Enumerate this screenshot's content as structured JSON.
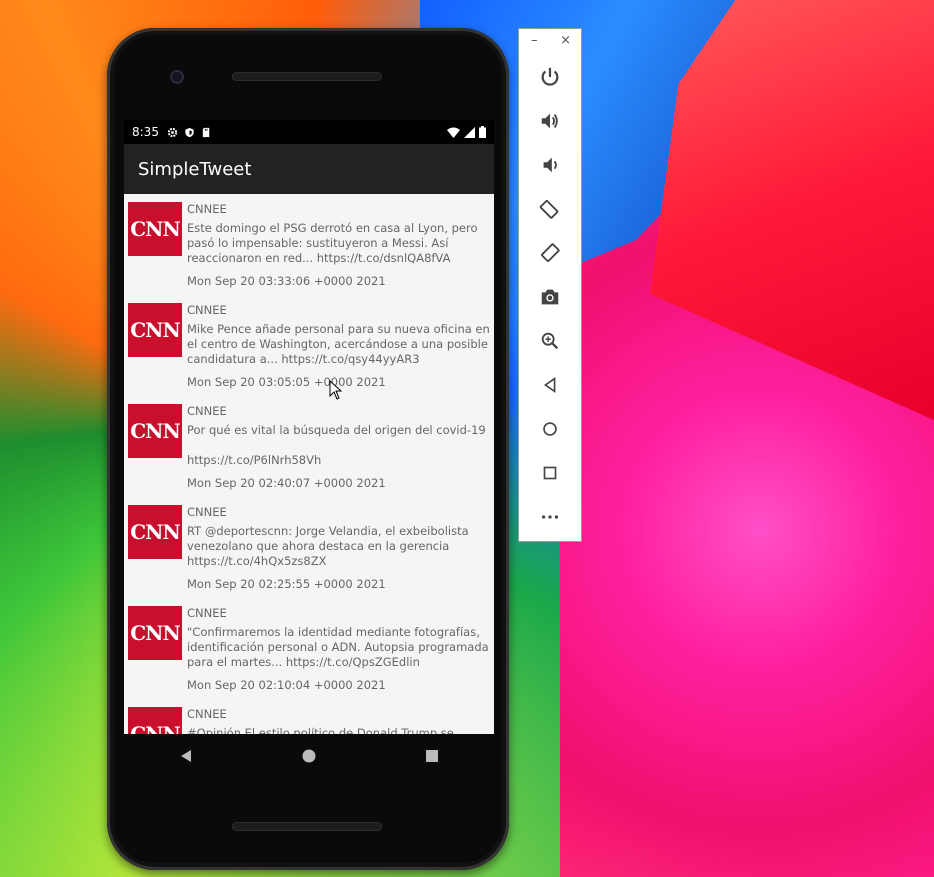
{
  "status_bar": {
    "time": "8:35"
  },
  "app": {
    "title": "SimpleTweet"
  },
  "tweets": [
    {
      "user": "CNNEE",
      "body": "Este domingo el PSG derrotó en casa al Lyon, pero\npasó lo impensable: sustituyeron a Messi. Así\nreaccionaron en red... https://t.co/dsnlQA8fVA",
      "date": "Mon Sep 20 03:33:06 +0000 2021",
      "avatar": "CNN"
    },
    {
      "user": "CNNEE",
      "body": "Mike Pence añade personal para su nueva oficina en\nel centro de Washington, acercándose a una posible\ncandidatura a... https://t.co/qsy44yyAR3",
      "date": "Mon Sep 20 03:05:05 +0000 2021",
      "avatar": "CNN"
    },
    {
      "user": "CNNEE",
      "body": "Por qué es vital la búsqueda del origen del covid-19\n\nhttps://t.co/P6lNrh58Vh",
      "date": "Mon Sep 20 02:40:07 +0000 2021",
      "avatar": "CNN"
    },
    {
      "user": "CNNEE",
      "body": "RT @deportescnn: Jorge Velandia, el exbeibolista\nvenezolano que ahora destaca en la gerencia\nhttps://t.co/4hQx5zs8ZX",
      "date": "Mon Sep 20 02:25:55 +0000 2021",
      "avatar": "CNN"
    },
    {
      "user": "CNNEE",
      "body": "\"Confirmaremos la identidad mediante fotografías,\nidentificación personal o ADN. Autopsia programada\npara el martes... https://t.co/QpsZGEdlin",
      "date": "Mon Sep 20 02:10:04 +0000 2021",
      "avatar": "CNN"
    },
    {
      "user": "CNNEE",
      "body": "#Opinión El estilo político de Donald Trump se",
      "date": "",
      "avatar": "CNN"
    }
  ],
  "emulator_panel": {
    "minimize": "–",
    "close": "×",
    "buttons": [
      "power-icon",
      "volume-up-icon",
      "volume-down-icon",
      "rotate-left-icon",
      "rotate-right-icon",
      "camera-icon",
      "zoom-icon",
      "back-icon",
      "home-icon",
      "overview-icon",
      "more-icon"
    ]
  }
}
